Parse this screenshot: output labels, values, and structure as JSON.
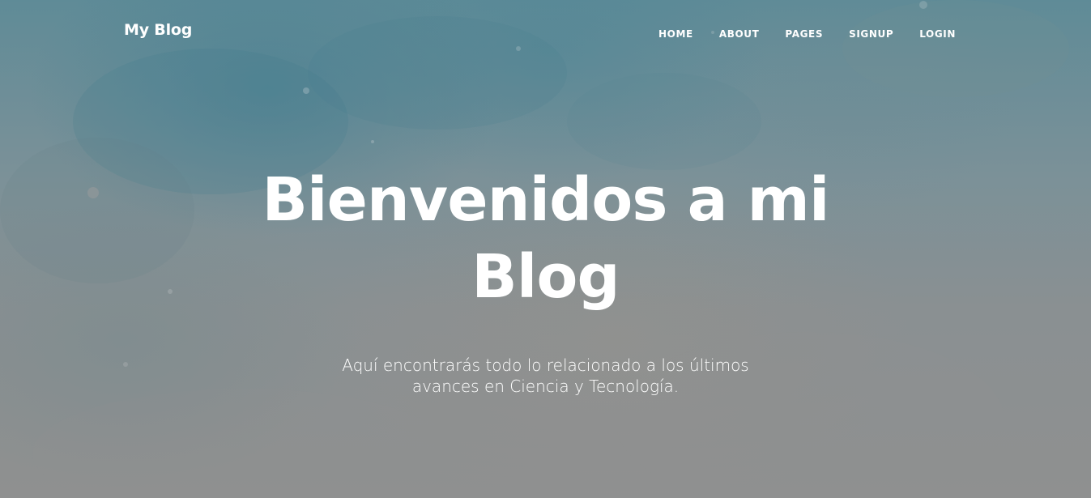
{
  "navbar": {
    "brand": "My Blog",
    "items": [
      {
        "label": "HOME"
      },
      {
        "label": "ABOUT"
      },
      {
        "label": "PAGES"
      },
      {
        "label": "SIGNUP"
      },
      {
        "label": "LOGIN"
      }
    ]
  },
  "hero": {
    "title": "Bienvenidos a mi Blog",
    "subtitle": "Aquí encontrarás todo lo relacionado a los últimos avances en Ciencia y Tecnología."
  },
  "colors": {
    "text": "#ffffff",
    "background_top": "#5f8b97",
    "background_bottom": "#8f9090"
  }
}
